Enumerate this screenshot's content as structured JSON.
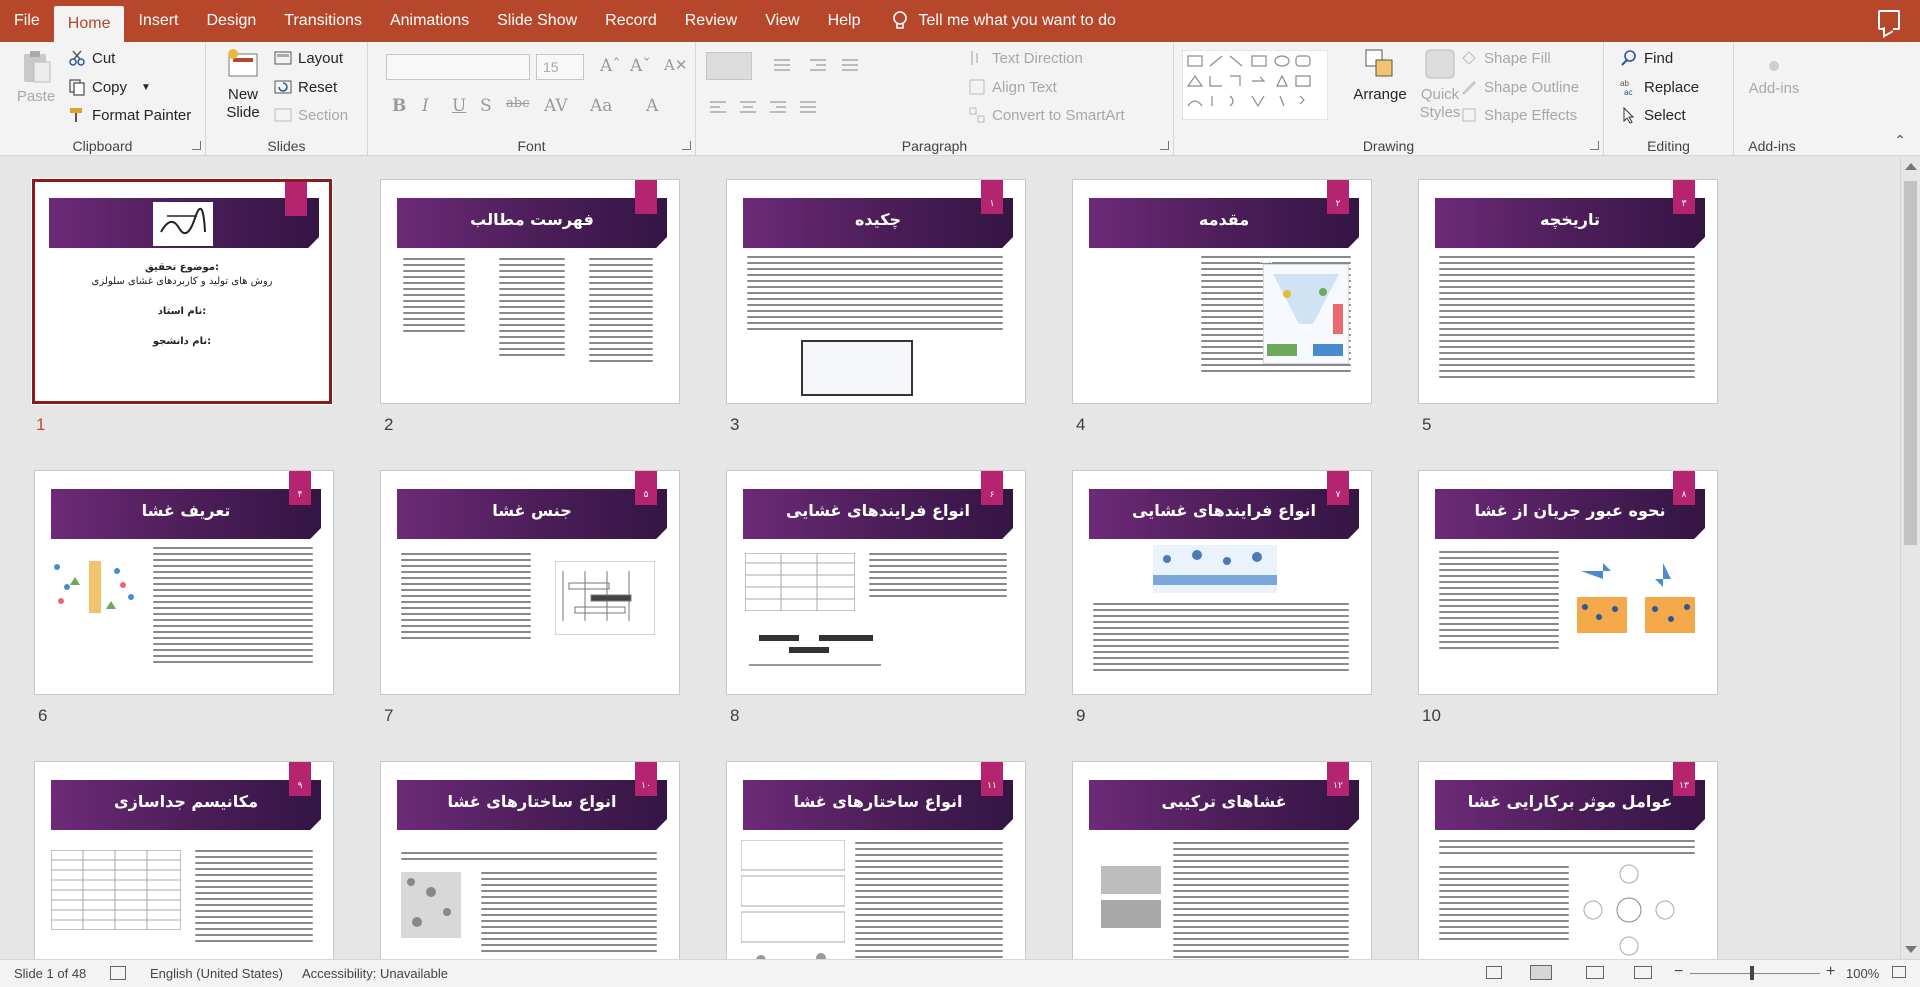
{
  "menu": {
    "tabs": [
      "File",
      "Home",
      "Insert",
      "Design",
      "Transitions",
      "Animations",
      "Slide Show",
      "Record",
      "Review",
      "View",
      "Help"
    ],
    "tell_me": "Tell me what you want to do"
  },
  "ribbon": {
    "clipboard": {
      "paste": "Paste",
      "cut": "Cut",
      "copy": "Copy",
      "format_painter": "Format Painter",
      "label": "Clipboard"
    },
    "slides": {
      "new_slide_1": "New",
      "new_slide_2": "Slide",
      "layout": "Layout",
      "reset": "Reset",
      "section": "Section",
      "label": "Slides"
    },
    "font": {
      "font_size": "15",
      "label": "Font"
    },
    "paragraph": {
      "text_direction": "Text Direction",
      "align_text": "Align Text",
      "smartart": "Convert to SmartArt",
      "label": "Paragraph"
    },
    "drawing": {
      "arrange": "Arrange",
      "quick_styles_1": "Quick",
      "quick_styles_2": "Styles",
      "shape_fill": "Shape Fill",
      "shape_outline": "Shape Outline",
      "shape_effects": "Shape Effects",
      "label": "Drawing"
    },
    "editing": {
      "find": "Find",
      "replace": "Replace",
      "select": "Select",
      "label": "Editing"
    },
    "addins": {
      "addins": "Add-ins",
      "label": "Add-ins"
    }
  },
  "slides": [
    {
      "num": "1",
      "title": "",
      "badge": ""
    },
    {
      "num": "2",
      "title": "فهرست مطالب",
      "badge": ""
    },
    {
      "num": "3",
      "title": "چکیده",
      "badge": "۱"
    },
    {
      "num": "4",
      "title": "مقدمه",
      "badge": "۲"
    },
    {
      "num": "5",
      "title": "تاریخچه",
      "badge": "۳"
    },
    {
      "num": "6",
      "title": "تعریف غشا",
      "badge": "۴"
    },
    {
      "num": "7",
      "title": "جنس غشا",
      "badge": "۵"
    },
    {
      "num": "8",
      "title": "انواع فرایندهای غشایی",
      "badge": "۶"
    },
    {
      "num": "9",
      "title": "انواع فرایندهای غشایی",
      "badge": "۷"
    },
    {
      "num": "10",
      "title": "نحوه عبور جریان از غشا",
      "badge": "۸"
    },
    {
      "num": "",
      "title": "مکانیسم جداسازی",
      "badge": "۹"
    },
    {
      "num": "",
      "title": "انواع ساختارهای غشا",
      "badge": "۱۰"
    },
    {
      "num": "",
      "title": "انواع ساختارهای غشا",
      "badge": "۱۱"
    },
    {
      "num": "",
      "title": "غشاهای ترکیبی",
      "badge": "۱۲"
    },
    {
      "num": "",
      "title": "عوامل موثر برکارایی غشا",
      "badge": "۱۳"
    }
  ],
  "title_slide": {
    "topic_label": "موضوع تحقیق:",
    "topic": "روش های تولید و کاربردهای غشای سلولزی",
    "teacher": "نام استاد:",
    "student": "نام دانشجو:"
  },
  "status": {
    "slide_of": "Slide 1 of 48",
    "language": "English (United States)",
    "accessibility": "Accessibility: Unavailable",
    "zoom": "100%"
  },
  "colors": {
    "accent": "#b7472a",
    "banner": "#4a1d57",
    "badge": "#b5256f"
  }
}
